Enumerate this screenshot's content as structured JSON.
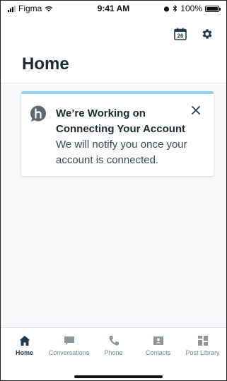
{
  "status_bar": {
    "carrier": "Figma",
    "time": "9:41 AM",
    "battery": "100%",
    "battery_level": 1.0
  },
  "header": {
    "title": "Home",
    "calendar_day": "26"
  },
  "notice": {
    "title": "We’re Working on Connecting Your Account",
    "body": "We will notify you once your account is connected.",
    "accent_color": "#8ed0ee"
  },
  "tabs": [
    {
      "label": "Home",
      "icon": "home-icon",
      "active": true
    },
    {
      "label": "Conversations",
      "icon": "chat-icon",
      "active": false
    },
    {
      "label": "Phone",
      "icon": "phone-icon",
      "active": false
    },
    {
      "label": "Contacts",
      "icon": "contact-card-icon",
      "active": false
    },
    {
      "label": "Post Library",
      "icon": "post-library-icon",
      "active": false
    }
  ],
  "colors": {
    "primary": "#1f3b4d",
    "inactive": "#8a969e",
    "background": "#f7f8fa"
  }
}
